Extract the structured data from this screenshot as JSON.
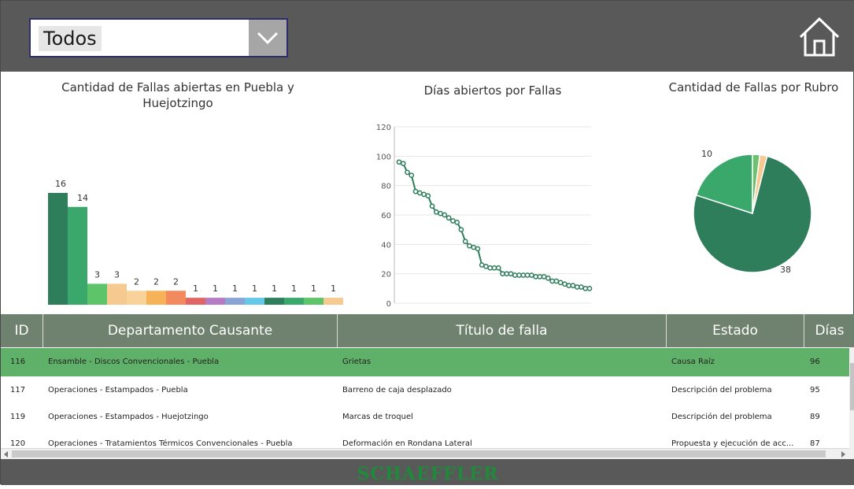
{
  "filter": {
    "selected": "Todos"
  },
  "colors": {
    "bar_dark": "#2e7d5b",
    "accent_green": "#5fb068",
    "header": "#6f826f"
  },
  "chart_data": [
    {
      "type": "bar",
      "title": "Cantidad de Fallas abiertas en Puebla y Huejotzingo",
      "values": [
        16,
        14,
        3,
        3,
        2,
        2,
        2,
        1,
        1,
        1,
        1,
        1,
        1,
        1,
        1
      ],
      "ylim": [
        0,
        16
      ]
    },
    {
      "type": "line",
      "title": "Días abiertos por Fallas",
      "yticks": [
        "0",
        "20",
        "40",
        "60",
        "80",
        "100",
        "120"
      ],
      "ylim": [
        0,
        120
      ],
      "values": [
        96,
        95,
        89,
        87,
        76,
        75,
        74,
        73,
        66,
        62,
        61,
        60,
        58,
        56,
        55,
        50,
        42,
        39,
        38,
        37,
        26,
        25,
        24,
        24,
        24,
        20,
        20,
        20,
        19,
        19,
        19,
        19,
        19,
        18,
        18,
        18,
        17,
        15,
        15,
        14,
        13,
        12,
        12,
        11,
        11,
        10,
        10
      ]
    },
    {
      "type": "pie",
      "title": "Cantidad de Fallas por Rubro",
      "values": [
        38,
        10,
        1,
        1
      ],
      "labels": [
        "38",
        "10"
      ]
    }
  ],
  "table": {
    "columns": [
      "ID",
      "Departamento Causante",
      "Título de falla",
      "Estado",
      "Días"
    ],
    "rows": [
      {
        "id": "116",
        "dept": "Ensamble - Discos Convencionales - Puebla",
        "title": "Grietas",
        "status": "Causa Raíz",
        "days": "96"
      },
      {
        "id": "117",
        "dept": "Operaciones - Estampados - Puebla",
        "title": "Barreno de caja desplazado",
        "status": "Descripción del problema",
        "days": "95"
      },
      {
        "id": "119",
        "dept": "Operaciones - Estampados - Huejotzingo",
        "title": "Marcas de troquel",
        "status": "Descripción del problema",
        "days": "89"
      },
      {
        "id": "120",
        "dept": "Operaciones - Tratamientos Térmicos Convencionales - Puebla",
        "title": "Deformación en Rondana Lateral",
        "status": "Propuesta y ejecución de acc...",
        "days": "87"
      }
    ]
  },
  "footer": {
    "brand": "SCHAEFFLER"
  }
}
